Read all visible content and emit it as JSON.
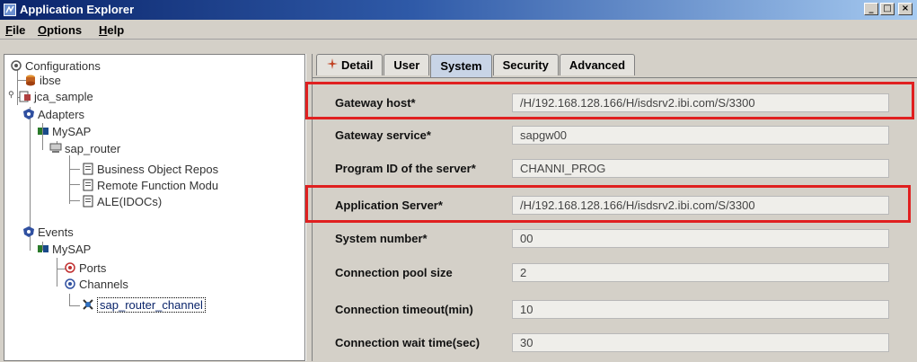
{
  "window": {
    "title": "Application Explorer",
    "icon": "app-explorer-icon",
    "buttons": {
      "minimize": "_",
      "maximize": "□",
      "close": "×"
    }
  },
  "menu": [
    {
      "label_ul": "F",
      "label_rest": "ile"
    },
    {
      "label_ul": "O",
      "label_rest": "ptions"
    },
    {
      "label_ul": "H",
      "label_rest": "elp"
    }
  ],
  "tree": {
    "configurations": "Configurations",
    "ibse": "ibse",
    "jca_sample": "jca_sample",
    "adapters": "Adapters",
    "mysap_adapter": "MySAP",
    "sap_router": "sap_router",
    "bor": "Business Object Repos",
    "rfm": "Remote Function Modu",
    "ale": "ALE(IDOCs)",
    "events": "Events",
    "mysap_events": "MySAP",
    "ports": "Ports",
    "channels": "Channels",
    "channel_item": "sap_router_channel"
  },
  "tabs": [
    "Detail",
    "User",
    "System",
    "Security",
    "Advanced"
  ],
  "active_tab": "System",
  "fields": [
    {
      "label": "Gateway host*",
      "value": "/H/192.168.128.166/H/isdsrv2.ibi.com/S/3300"
    },
    {
      "label": "Gateway service*",
      "value": "sapgw00"
    },
    {
      "label": "Program ID of the server*",
      "value": "CHANNI_PROG"
    },
    {
      "label": "Application Server*",
      "value": "/H/192.168.128.166/H/isdsrv2.ibi.com/S/3300"
    },
    {
      "label": "System number*",
      "value": "00"
    },
    {
      "label": "Connection pool size",
      "value": "2"
    },
    {
      "label": "Connection timeout(min)",
      "value": "10"
    },
    {
      "label": "Connection wait time(sec)",
      "value": "30"
    }
  ],
  "colors": {
    "highlight": "#e02020",
    "title_bar": "#0a246a"
  }
}
